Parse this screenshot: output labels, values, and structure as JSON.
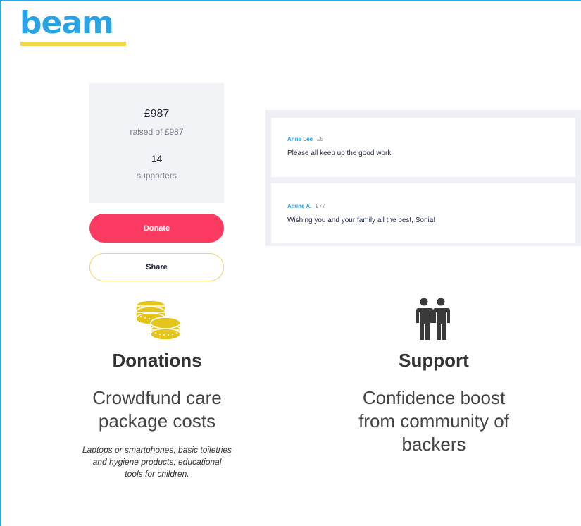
{
  "brand": {
    "name": "beam",
    "text_color": "#2aa3e4",
    "underline_color": "#f7d54a"
  },
  "campaign": {
    "raised_amount": "£987",
    "raised_of": "raised of £987",
    "supporter_count": "14",
    "supporters_label": "supporters"
  },
  "actions": {
    "donate_label": "Donate",
    "share_label": "Share",
    "donate_color": "#fb3a62",
    "share_border_color": "#f2d46a"
  },
  "messages": [
    {
      "name": "Anne Lee",
      "amount": "£5",
      "text": "Please all keep up the good work"
    },
    {
      "name": "Amine A.",
      "amount": "£77",
      "text": "Wishing you and your family all the best, Sonia!"
    }
  ],
  "features": [
    {
      "icon": "coins-icon",
      "title": "Donations",
      "description_lines": [
        "Crowdfund care",
        "package costs"
      ],
      "note_lines": [
        "Laptops or smartphones; basic toiletries",
        "and hygiene products; educational",
        "tools for children."
      ]
    },
    {
      "icon": "people-icon",
      "title": "Support",
      "description_lines": [
        "Confidence boost",
        "from community of",
        "backers"
      ]
    }
  ],
  "colors": {
    "frame_border": "#2da8e6",
    "card_background": "#f1f3f7",
    "messages_background": "#eef0f5",
    "coin_gold": "#e3c51c"
  }
}
